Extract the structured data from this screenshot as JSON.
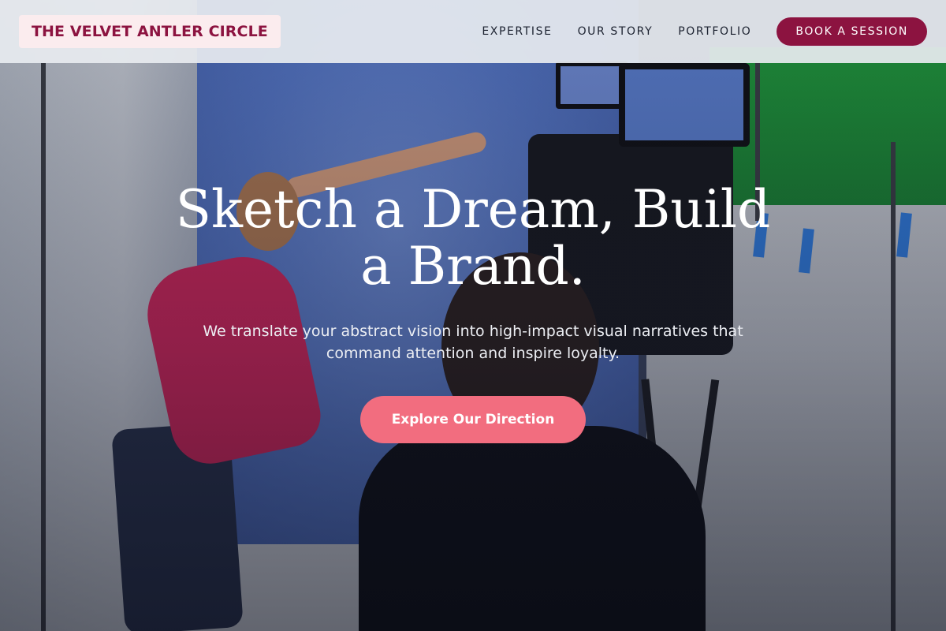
{
  "brand": {
    "name": "THE VELVET ANTLER CIRCLE"
  },
  "nav": {
    "links": [
      "EXPERTISE",
      "OUR STORY",
      "PORTFOLIO"
    ],
    "cta": "BOOK A SESSION"
  },
  "hero": {
    "title": "Sketch a Dream, Build a Brand.",
    "subtitle": "We translate your abstract vision into high-impact visual narratives that command attention and inspire loyalty.",
    "cta": "Explore Our Direction"
  },
  "colors": {
    "brand": "#8c1340",
    "brand_bg": "#fbecee",
    "cta": "#f26d7f",
    "navbar": "#e8ecf0"
  }
}
